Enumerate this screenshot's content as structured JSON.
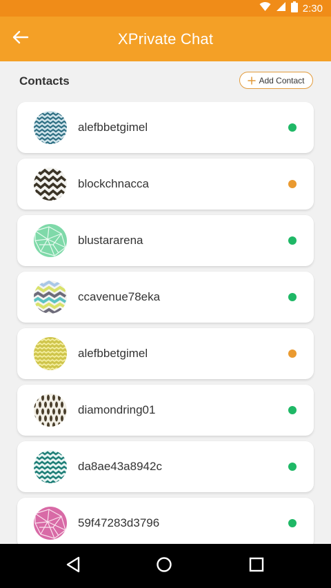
{
  "status_bar": {
    "time": "2:30",
    "icons": [
      "wifi-icon",
      "cellular-signal-icon",
      "battery-icon"
    ]
  },
  "app_bar": {
    "title": "XPrivate Chat",
    "back_icon": "arrow-left-icon"
  },
  "contacts_section": {
    "title": "Contacts",
    "add_button_label": "Add Contact",
    "add_button_icon": "plus-icon"
  },
  "contacts": [
    {
      "name": "alefbbetgimel",
      "status": "online",
      "avatar_pattern": "zigzag-blue"
    },
    {
      "name": "blockchnacca",
      "status": "away",
      "avatar_pattern": "zigzag-dark"
    },
    {
      "name": "blustararena",
      "status": "online",
      "avatar_pattern": "triangles-green"
    },
    {
      "name": "ccavenue78eka",
      "status": "online",
      "avatar_pattern": "chevron-multicolor"
    },
    {
      "name": "alefbbetgimel",
      "status": "away",
      "avatar_pattern": "zigzag-yellow"
    },
    {
      "name": "diamondring01",
      "status": "online",
      "avatar_pattern": "drops-brown"
    },
    {
      "name": "da8ae43a8942c",
      "status": "online",
      "avatar_pattern": "zigzag-teal"
    },
    {
      "name": "59f47283d3796",
      "status": "online",
      "avatar_pattern": "triangles-pink"
    }
  ],
  "status_colors": {
    "online": "#1fb866",
    "away": "#ea9a30"
  },
  "colors": {
    "status_bar": "#f08c18",
    "app_bar": "#f4a026",
    "background": "#f1f1f1",
    "add_button_border": "#e29a3a"
  },
  "nav_bar": {
    "icons": [
      "back-triangle-icon",
      "home-circle-icon",
      "recents-square-icon"
    ]
  }
}
